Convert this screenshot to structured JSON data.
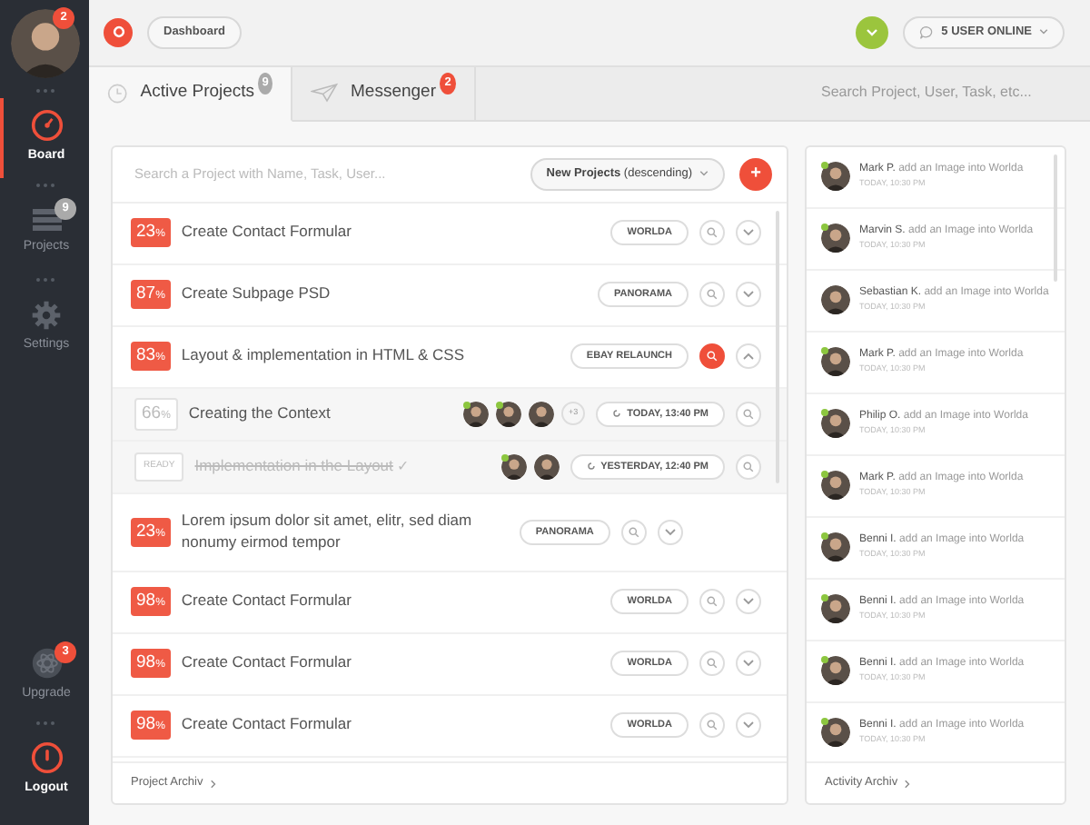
{
  "sidebar": {
    "profile_badge": "2",
    "items": [
      {
        "label": "Board",
        "selected": true
      },
      {
        "label": "Projects",
        "selected": false,
        "badge": "9"
      },
      {
        "label": "Settings",
        "selected": false
      }
    ],
    "bottom_items": [
      {
        "label": "Upgrade",
        "badge": "3"
      },
      {
        "label": "Logout"
      }
    ]
  },
  "top_bar": {
    "breadcrumb": "Dashboard",
    "users_online": "5 USER ONLINE"
  },
  "tabs": [
    {
      "label": "Active Projects",
      "badge": "9",
      "selected": true
    },
    {
      "label": "Messenger",
      "badge": "2",
      "selected": false
    }
  ],
  "global_search": {
    "placeholder": "Search Project, User, Task, etc..."
  },
  "projects": {
    "search_placeholder": "Search a Project with Name, Task, User...",
    "sort": "**New Projects** (descending)",
    "add_button": "+",
    "rows": [
      {
        "kind": "project",
        "percent": "23",
        "unit": "%",
        "title": "Create Contact Formular",
        "tag": "WORLDA",
        "expanded": false,
        "search_active": false
      },
      {
        "kind": "project",
        "percent": "87",
        "unit": "%",
        "title": "Create Subpage PSD",
        "tag": "PANORAMA",
        "expanded": false,
        "search_active": false
      },
      {
        "kind": "project",
        "percent": "83",
        "unit": "%",
        "title": "Layout & implementation in HTML & CSS",
        "tag": "EBAY RELAUNCH",
        "expanded": true,
        "search_active": true
      },
      {
        "kind": "task",
        "percent": "66",
        "unit": "%",
        "title": "Creating the Context",
        "done": false,
        "members": [
          {
            "online": true
          },
          {
            "online": true
          },
          {
            "online": false
          }
        ],
        "more": "+3",
        "time": "TODAY, 13:40 PM"
      },
      {
        "kind": "task",
        "status": "READY",
        "title": "Implementation in the Layout",
        "check": "✓",
        "done": true,
        "members": [
          {
            "online": true
          },
          {
            "online": false
          }
        ],
        "time": "YESTERDAY, 12:40 PM"
      },
      {
        "kind": "project",
        "percent": "23",
        "unit": "%",
        "title": "Lorem ipsum dolor sit amet, elitr, sed diam nonumy eirmod tempor",
        "tag": "PANORAMA",
        "expanded": false,
        "search_active": false
      },
      {
        "kind": "project",
        "percent": "98",
        "unit": "%",
        "title": "Create Contact Formular",
        "tag": "WORLDA",
        "expanded": false,
        "search_active": false
      },
      {
        "kind": "project",
        "percent": "98",
        "unit": "%",
        "title": "Create Contact Formular",
        "tag": "WORLDA",
        "expanded": false,
        "search_active": false
      },
      {
        "kind": "project",
        "percent": "98",
        "unit": "%",
        "title": "Create Contact Formular",
        "tag": "WORLDA",
        "expanded": false,
        "search_active": false
      }
    ],
    "footer": "Project Archiv"
  },
  "activity": {
    "items": [
      {
        "user": "Mark P.",
        "text": "add an Image into Worlda",
        "time": "TODAY, 10:30 PM",
        "online": true
      },
      {
        "user": "Marvin S.",
        "text": "add an Image into Worlda",
        "time": "TODAY, 10:30 PM",
        "online": true
      },
      {
        "user": "Sebastian K.",
        "text": "add an Image into Worlda",
        "time": "TODAY, 10:30 PM",
        "online": false
      },
      {
        "user": "Mark P.",
        "text": "add an Image into Worlda",
        "time": "TODAY, 10:30 PM",
        "online": true
      },
      {
        "user": "Philip O.",
        "text": "add an Image into Worlda",
        "time": "TODAY, 10:30 PM",
        "online": true
      },
      {
        "user": "Mark P.",
        "text": "add an Image into Worlda",
        "time": "TODAY, 10:30 PM",
        "online": true
      },
      {
        "user": "Benni I.",
        "text": "add an Image into Worlda",
        "time": "TODAY, 10:30 PM",
        "online": true
      },
      {
        "user": "Benni I.",
        "text": "add an Image into Worlda",
        "time": "TODAY, 10:30 PM",
        "online": true
      },
      {
        "user": "Benni I.",
        "text": "add an Image into Worlda",
        "time": "TODAY, 10:30 PM",
        "online": true
      },
      {
        "user": "Benni I.",
        "text": "add an Image into Worlda",
        "time": "TODAY, 10:30 PM",
        "online": true
      }
    ],
    "footer": "Activity Archiv"
  }
}
